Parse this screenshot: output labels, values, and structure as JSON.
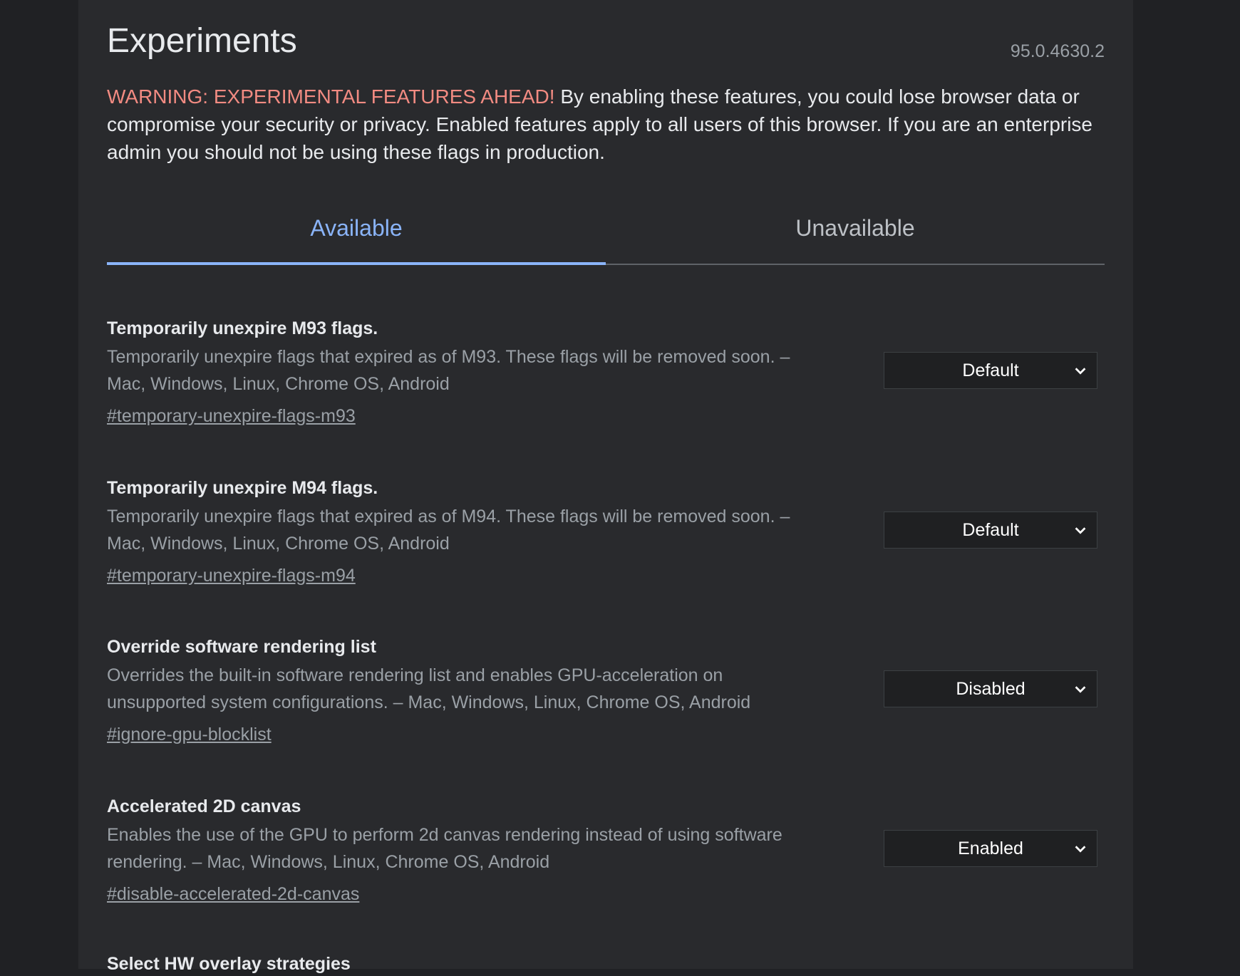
{
  "header": {
    "title": "Experiments",
    "version": "95.0.4630.2",
    "warning_label": "WARNING: EXPERIMENTAL FEATURES AHEAD!",
    "warning_text": " By enabling these features, you could lose browser data or compromise your security or privacy. Enabled features apply to all users of this browser. If you are an enterprise admin you should not be using these flags in production."
  },
  "tabs": [
    {
      "label": "Available",
      "active": true
    },
    {
      "label": "Unavailable",
      "active": false
    }
  ],
  "flags": [
    {
      "title": "Temporarily unexpire M93 flags.",
      "description": "Temporarily unexpire flags that expired as of M93. These flags will be removed soon. – Mac, Windows, Linux, Chrome OS, Android",
      "link": "#temporary-unexpire-flags-m93",
      "value": "Default"
    },
    {
      "title": "Temporarily unexpire M94 flags.",
      "description": "Temporarily unexpire flags that expired as of M94. These flags will be removed soon. – Mac, Windows, Linux, Chrome OS, Android",
      "link": "#temporary-unexpire-flags-m94",
      "value": "Default"
    },
    {
      "title": "Override software rendering list",
      "description": "Overrides the built-in software rendering list and enables GPU-acceleration on unsupported system configurations. – Mac, Windows, Linux, Chrome OS, Android",
      "link": "#ignore-gpu-blocklist",
      "value": "Disabled"
    },
    {
      "title": "Accelerated 2D canvas",
      "description": "Enables the use of the GPU to perform 2d canvas rendering instead of using software rendering. – Mac, Windows, Linux, Chrome OS, Android",
      "link": "#disable-accelerated-2d-canvas",
      "value": "Enabled"
    },
    {
      "title": "Select HW overlay strategies"
    }
  ],
  "colors": {
    "background": "#202124",
    "panel": "#292a2d",
    "accent": "#8ab4f8",
    "warning": "#f28b82"
  },
  "icons": {
    "dropdown": "chevron-down-icon"
  }
}
